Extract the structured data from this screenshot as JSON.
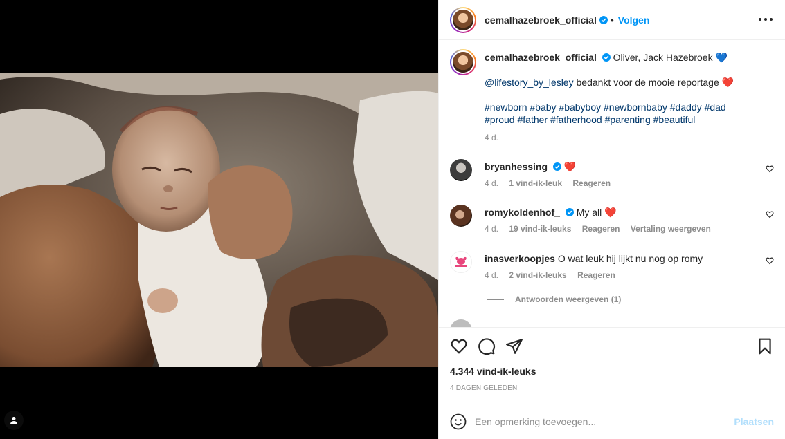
{
  "post": {
    "username": "cemalhazebroek_official",
    "follow_label": "Volgen",
    "caption_name": "Oliver, Jack Hazebroek",
    "caption_heart": "💙",
    "mention": "@lifestory_by_lesley",
    "mention_text": "bedankt voor de mooie reportage",
    "mention_heart": "❤️",
    "hashtags_line1": "#newborn #baby #babyboy #newbornbaby #daddy #dad",
    "hashtags_line2": "#proud #father #fatherhood #parenting #beautiful",
    "caption_age": "4 d."
  },
  "comments": [
    {
      "user": "bryanhessing",
      "verified": true,
      "text": "❤️",
      "age": "4 d.",
      "likes": "1 vind-ik-leuk",
      "reply": "Reageren",
      "translate": ""
    },
    {
      "user": "romykoldenhof_",
      "verified": true,
      "text": "My all ❤️",
      "age": "4 d.",
      "likes": "19 vind-ik-leuks",
      "reply": "Reageren",
      "translate": "Vertaling weergeven"
    },
    {
      "user": "inasverkoopjes",
      "verified": false,
      "text": "O wat leuk hij lijkt nu nog op romy",
      "age": "4 d.",
      "likes": "2 vind-ik-leuks",
      "reply": "Reageren",
      "translate": ""
    }
  ],
  "view_replies": "Antwoorden weergeven (1)",
  "like_count": "4.344 vind-ik-leuks",
  "posted_ago": "4 DAGEN GELEDEN",
  "add_comment": {
    "placeholder": "Een opmerking toevoegen...",
    "post_label": "Plaatsen"
  },
  "colors": {
    "accent": "#0095f6",
    "link": "#00376b",
    "muted": "#8e8e8e",
    "heart_red": "#ed4956"
  },
  "icons": [
    "tag-user-icon",
    "verified-badge-icon",
    "more-options-icon",
    "heart-icon",
    "comment-icon",
    "share-icon",
    "bookmark-icon",
    "emoji-icon",
    "small-heart-icon"
  ]
}
